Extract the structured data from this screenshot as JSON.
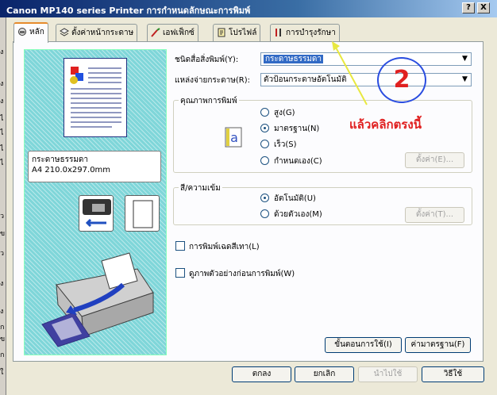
{
  "window": {
    "title": "Canon MP140 series Printer การกำหนดลักษณะการพิมพ์",
    "help_btn": "?",
    "close_btn": "X"
  },
  "tabs": [
    {
      "label": "หลัก",
      "icon": "main-icon"
    },
    {
      "label": "ตั้งค่าหน้ากระดาษ",
      "icon": "page-setup-icon"
    },
    {
      "label": "เอฟเฟ็กซ์",
      "icon": "effects-icon"
    },
    {
      "label": "โปรไฟล์",
      "icon": "profiles-icon"
    },
    {
      "label": "การบำรุงรักษา",
      "icon": "maintenance-icon"
    }
  ],
  "preview": {
    "paper_line1": "กระดาษธรรมดา",
    "paper_line2": "A4 210.0x297.0mm"
  },
  "media_type": {
    "label": "ชนิดสื่อสิ่งพิมพ์(Y):",
    "value": "กระดาษธรรมดา"
  },
  "paper_source": {
    "label": "แหล่งจ่ายกระดาษ(R):",
    "value": "ตัวป้อนกระดาษอัตโนมัติ"
  },
  "print_quality": {
    "title": "คุณภาพการพิมพ์",
    "options": [
      "สูง(G)",
      "มาตรฐาน(N)",
      "เร็ว(S)",
      "กำหนดเอง(C)"
    ],
    "selected": "มาตรฐาน(N)",
    "set_button": "ตั้งค่า(E)..."
  },
  "color_intensity": {
    "title": "สี/ความเข้ม",
    "options": [
      "อัตโนมัติ(U)",
      "ด้วยตัวเอง(M)"
    ],
    "selected": "อัตโนมัติ(U)",
    "set_button": "ตั้งค่า(T)..."
  },
  "grayscale": {
    "label": "การพิมพ์เฉดสีเทา(L)",
    "checked": false
  },
  "preview_before": {
    "label": "ดูภาพตัวอย่างก่อนการพิมพ์(W)",
    "checked": false
  },
  "buttons": {
    "instructions": "ขั้นตอนการใช้(I)",
    "defaults": "ค่ามาตรฐาน(F)",
    "ok": "ตกลง",
    "cancel": "ยกเลิก",
    "apply": "นำไปใช้",
    "help": "วิธีใช้"
  },
  "annotation": {
    "number": "2",
    "text": "แล้วคลิกตรงนี้",
    "color": "#e02020"
  },
  "left_bg_chars": [
    "ง",
    "ง",
    "ง",
    "ไ",
    "ไ",
    "ไ",
    "ไ",
    "ว",
    "ข",
    "ว",
    "ง",
    "ง",
    "ก",
    "ข",
    "ก",
    "ใ"
  ]
}
